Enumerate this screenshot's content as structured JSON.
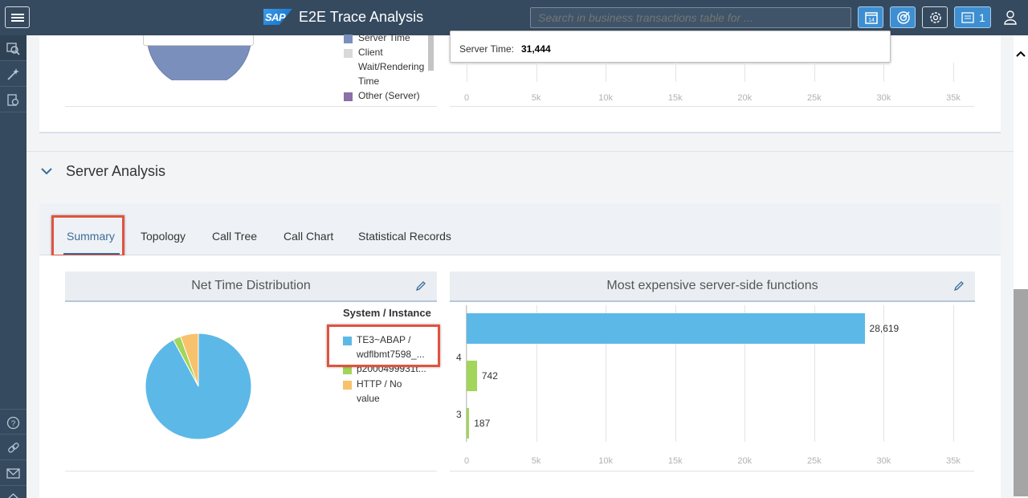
{
  "header": {
    "app_title": "E2E Trace Analysis",
    "search_placeholder": "Search in business transactions table for ...",
    "notification_count": "1",
    "sap_logo_text": "SAP"
  },
  "top_section": {
    "legend": [
      {
        "label": "Server Time",
        "color": "#7b8fbd"
      },
      {
        "label": "Client Wait/Rendering Time",
        "color": "#d9d9d9"
      },
      {
        "label": "Other (Server)",
        "color": "#8b6fa7"
      }
    ],
    "tooltip": {
      "label": "Server Time:",
      "value": "31,444"
    },
    "x_ticks": [
      "0",
      "5k",
      "10k",
      "15k",
      "20k",
      "25k",
      "30k",
      "35k"
    ]
  },
  "server_analysis": {
    "title": "Server Analysis",
    "tabs": [
      "Summary",
      "Topology",
      "Call Tree",
      "Call Chart",
      "Statistical Records"
    ],
    "selected_tab": "Summary"
  },
  "net_time_panel": {
    "title": "Net Time Distribution",
    "legend_title": "System / Instance",
    "legend": [
      {
        "label_line1": "TE3~ABAP /",
        "label_line2": "wdflbmt7598_...",
        "color": "#5cb8e7"
      },
      {
        "label_line1": "p2000499931t...",
        "label_line2": "",
        "color": "#a3d55a"
      },
      {
        "label_line1": "HTTP / No",
        "label_line2": "value",
        "color": "#f7c26b"
      }
    ]
  },
  "expensive_panel": {
    "title": "Most expensive server-side functions",
    "x_ticks": [
      "0",
      "5k",
      "10k",
      "15k",
      "20k",
      "25k",
      "30k",
      "35k"
    ]
  },
  "chart_data": [
    {
      "type": "pie",
      "title": "Net Time Distribution",
      "legend_title": "System / Instance",
      "categories": [
        "TE3~ABAP / wdflbmt7598_...",
        "p2000499931t...",
        "HTTP / No value"
      ],
      "values": [
        28619,
        742,
        1700
      ],
      "colors": [
        "#5cb8e7",
        "#a3d55a",
        "#f7c26b"
      ]
    },
    {
      "type": "bar",
      "orientation": "horizontal",
      "title": "Most expensive server-side functions",
      "categories": [
        "",
        "4",
        "3"
      ],
      "values": [
        28619,
        742,
        187
      ],
      "data_labels": [
        "28,619",
        "742",
        "187"
      ],
      "colors": [
        "#5cb8e7",
        "#a3d55a",
        "#a3d55a"
      ],
      "xlim": [
        0,
        35000
      ],
      "x_ticks": [
        0,
        5000,
        10000,
        15000,
        20000,
        25000,
        30000,
        35000
      ],
      "grid": true
    }
  ]
}
